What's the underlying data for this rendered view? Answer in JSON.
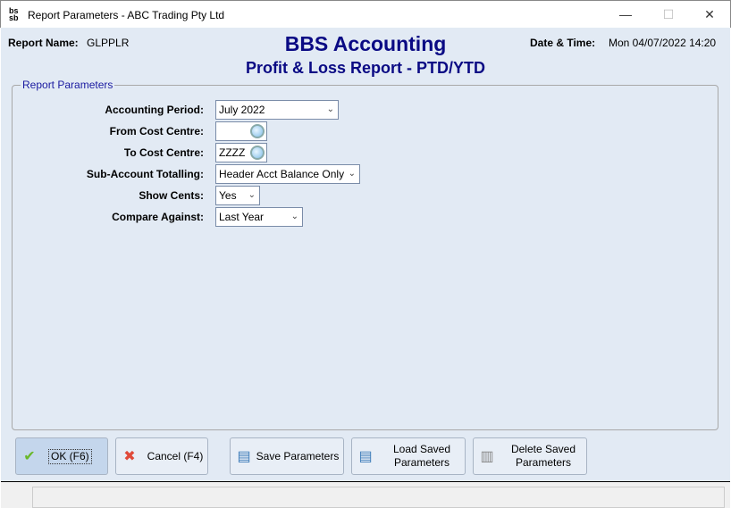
{
  "window": {
    "title": "Report Parameters - ABC Trading Pty Ltd",
    "app_icon": "bbs-logo-icon",
    "minimize": "—",
    "maximize": "☐",
    "close": "✕"
  },
  "header": {
    "report_name_label": "Report Name:",
    "report_name": "GLPPLR",
    "title": "BBS Accounting",
    "subtitle": "Profit & Loss Report - PTD/YTD",
    "datetime_label": "Date & Time:",
    "datetime": "Mon 04/07/2022 14:20",
    "title_color": "#0a0a84"
  },
  "params": {
    "legend": "Report Parameters",
    "fields": [
      {
        "label": "Accounting Period:",
        "value": "July 2022",
        "type": "dropdown"
      },
      {
        "label": "From Cost Centre:",
        "value": "",
        "type": "lookup"
      },
      {
        "label": "To Cost Centre:",
        "value": "ZZZZ",
        "type": "lookup"
      },
      {
        "label": "Sub-Account Totalling:",
        "value": "Header Acct Balance Only",
        "type": "dropdown"
      },
      {
        "label": "Show Cents:",
        "value": "Yes",
        "type": "dropdown"
      },
      {
        "label": "Compare Against:",
        "value": "Last Year",
        "type": "dropdown"
      }
    ]
  },
  "buttons": {
    "ok": "OK (F6)",
    "cancel": "Cancel (F4)",
    "save": "Save Parameters",
    "load_1": "Load Saved",
    "load_2": "Parameters",
    "delete_1": "Delete Saved",
    "delete_2": "Parameters"
  }
}
